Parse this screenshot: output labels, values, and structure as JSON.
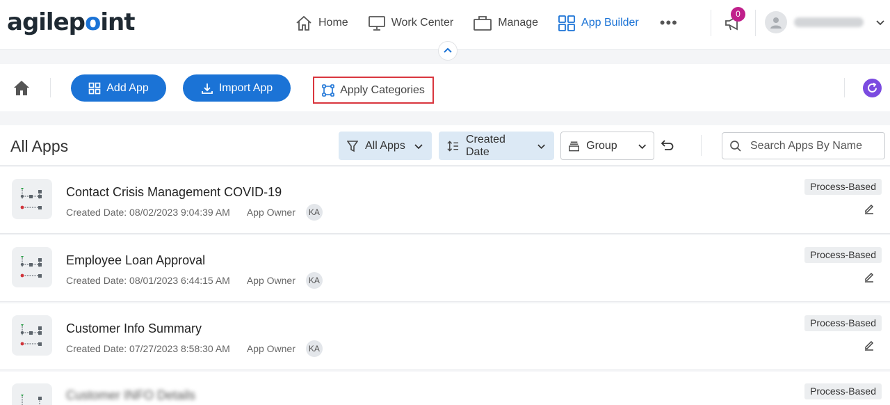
{
  "brand": {
    "logo_prefix": "agilep",
    "logo_dot": "o",
    "logo_suffix": "int"
  },
  "nav": {
    "items": [
      {
        "label": "Home",
        "icon": "home-outline-icon"
      },
      {
        "label": "Work Center",
        "icon": "monitor-icon"
      },
      {
        "label": "Manage",
        "icon": "briefcase-icon"
      },
      {
        "label": "App Builder",
        "icon": "grid-icon",
        "active": true
      }
    ],
    "more": "•••"
  },
  "notifications": {
    "count": "0"
  },
  "toolbar": {
    "add_app": "Add App",
    "import_app": "Import App",
    "apply_categories": "Apply Categories"
  },
  "header": {
    "title": "All Apps",
    "filter_label": "All Apps",
    "sort_label": "Created Date",
    "group_label": "Group",
    "search_placeholder": "Search Apps By Name"
  },
  "apps": [
    {
      "name": "Contact Crisis Management COVID-19",
      "created": "Created Date: 08/02/2023 9:04:39 AM",
      "owner_label": "App Owner",
      "owner_initials": "KA",
      "type": "Process-Based"
    },
    {
      "name": "Employee Loan Approval",
      "created": "Created Date: 08/01/2023 6:44:15 AM",
      "owner_label": "App Owner",
      "owner_initials": "KA",
      "type": "Process-Based"
    },
    {
      "name": "Customer Info Summary",
      "created": "Created Date: 07/27/2023 8:58:30 AM",
      "owner_label": "App Owner",
      "owner_initials": "KA",
      "type": "Process-Based"
    },
    {
      "name": "Customer INFO Details",
      "type": "Process-Based"
    }
  ],
  "colors": {
    "primary": "#1b73d6",
    "badge": "#c0208b",
    "refresh": "#7b4be0",
    "highlight_border": "#d9363e"
  }
}
